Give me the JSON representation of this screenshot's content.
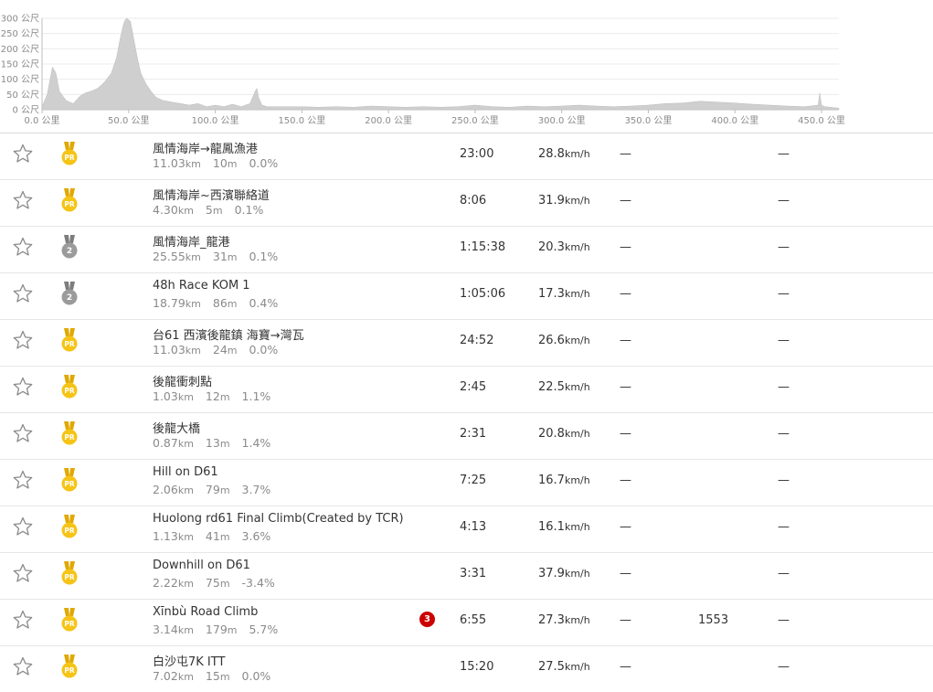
{
  "chart_data": {
    "type": "area",
    "ylim": [
      0,
      300
    ],
    "xlim": [
      0,
      460
    ],
    "y_ticks": [
      "0 公尺",
      "50 公尺",
      "100 公尺",
      "150 公尺",
      "200 公尺",
      "250 公尺",
      "300 公尺"
    ],
    "y_tick_values": [
      0,
      50,
      100,
      150,
      200,
      250,
      300
    ],
    "x_ticks": [
      "0.0 公里",
      "50.0 公里",
      "100.0 公里",
      "150.0 公里",
      "200.0 公里",
      "250.0 公里",
      "300.0 公里",
      "350.0 公里",
      "400.0 公里",
      "450.0 公里"
    ],
    "x_tick_values": [
      0,
      50,
      100,
      150,
      200,
      250,
      300,
      350,
      400,
      450
    ],
    "grid": true,
    "fill_color": "#cfcfcf",
    "x": [
      0,
      3,
      6,
      8,
      10,
      14,
      18,
      22,
      25,
      28,
      32,
      36,
      40,
      43,
      45,
      47,
      48,
      49,
      51,
      53,
      55,
      57,
      60,
      63,
      66,
      70,
      75,
      80,
      85,
      90,
      95,
      100,
      105,
      110,
      115,
      120,
      123,
      124,
      125,
      127,
      130,
      140,
      150,
      160,
      170,
      180,
      190,
      200,
      210,
      220,
      230,
      240,
      250,
      260,
      270,
      280,
      290,
      300,
      310,
      320,
      330,
      340,
      350,
      360,
      370,
      380,
      390,
      400,
      410,
      420,
      430,
      440,
      448,
      449,
      450,
      452,
      455,
      460
    ],
    "y": [
      10,
      50,
      140,
      120,
      60,
      30,
      20,
      45,
      55,
      60,
      70,
      90,
      120,
      170,
      230,
      280,
      295,
      300,
      290,
      230,
      170,
      120,
      85,
      60,
      40,
      30,
      25,
      20,
      15,
      20,
      10,
      15,
      10,
      18,
      10,
      20,
      60,
      70,
      40,
      15,
      10,
      10,
      10,
      8,
      10,
      8,
      12,
      10,
      8,
      10,
      8,
      10,
      15,
      10,
      8,
      12,
      10,
      12,
      15,
      12,
      10,
      12,
      15,
      20,
      22,
      28,
      25,
      22,
      18,
      15,
      12,
      10,
      15,
      55,
      15,
      10,
      8,
      5
    ]
  },
  "segments": [
    {
      "name": "風情海岸→龍鳳漁港",
      "distance": "11.03",
      "distance_unit": "km",
      "elev": "10",
      "elev_unit": "m",
      "grade": "0.0%",
      "medal": "pr",
      "medal_label": "PR",
      "time": "23:00",
      "speed": "28.8",
      "speed_unit": "km/h",
      "dash1": "—",
      "extra": "",
      "dash2": "—",
      "kom_rank": ""
    },
    {
      "name": "風情海岸~西濱聯絡道",
      "distance": "4.30",
      "distance_unit": "km",
      "elev": "5",
      "elev_unit": "m",
      "grade": "0.1%",
      "medal": "pr",
      "medal_label": "PR",
      "time": "8:06",
      "speed": "31.9",
      "speed_unit": "km/h",
      "dash1": "—",
      "extra": "",
      "dash2": "—",
      "kom_rank": ""
    },
    {
      "name": "風情海岸_龍港",
      "distance": "25.55",
      "distance_unit": "km",
      "elev": "31",
      "elev_unit": "m",
      "grade": "0.1%",
      "medal": "silver",
      "medal_label": "2",
      "time": "1:15:38",
      "speed": "20.3",
      "speed_unit": "km/h",
      "dash1": "—",
      "extra": "",
      "dash2": "—",
      "kom_rank": ""
    },
    {
      "name": "48h Race KOM 1",
      "distance": "18.79",
      "distance_unit": "km",
      "elev": "86",
      "elev_unit": "m",
      "grade": "0.4%",
      "medal": "silver",
      "medal_label": "2",
      "time": "1:05:06",
      "speed": "17.3",
      "speed_unit": "km/h",
      "dash1": "—",
      "extra": "",
      "dash2": "—",
      "kom_rank": ""
    },
    {
      "name": "台61 西濱後龍鎮 海寶→灣瓦",
      "distance": "11.03",
      "distance_unit": "km",
      "elev": "24",
      "elev_unit": "m",
      "grade": "0.0%",
      "medal": "pr",
      "medal_label": "PR",
      "time": "24:52",
      "speed": "26.6",
      "speed_unit": "km/h",
      "dash1": "—",
      "extra": "",
      "dash2": "—",
      "kom_rank": ""
    },
    {
      "name": "後龍衝刺點",
      "distance": "1.03",
      "distance_unit": "km",
      "elev": "12",
      "elev_unit": "m",
      "grade": "1.1%",
      "medal": "pr",
      "medal_label": "PR",
      "time": "2:45",
      "speed": "22.5",
      "speed_unit": "km/h",
      "dash1": "—",
      "extra": "",
      "dash2": "—",
      "kom_rank": ""
    },
    {
      "name": "後龍大橋",
      "distance": "0.87",
      "distance_unit": "km",
      "elev": "13",
      "elev_unit": "m",
      "grade": "1.4%",
      "medal": "pr",
      "medal_label": "PR",
      "time": "2:31",
      "speed": "20.8",
      "speed_unit": "km/h",
      "dash1": "—",
      "extra": "",
      "dash2": "—",
      "kom_rank": ""
    },
    {
      "name": "Hill on D61",
      "distance": "2.06",
      "distance_unit": "km",
      "elev": "79",
      "elev_unit": "m",
      "grade": "3.7%",
      "medal": "pr",
      "medal_label": "PR",
      "time": "7:25",
      "speed": "16.7",
      "speed_unit": "km/h",
      "dash1": "—",
      "extra": "",
      "dash2": "—",
      "kom_rank": ""
    },
    {
      "name": "Huolong rd61 Final Climb(Created by TCR)",
      "distance": "1.13",
      "distance_unit": "km",
      "elev": "41",
      "elev_unit": "m",
      "grade": "3.6%",
      "medal": "pr",
      "medal_label": "PR",
      "time": "4:13",
      "speed": "16.1",
      "speed_unit": "km/h",
      "dash1": "—",
      "extra": "",
      "dash2": "—",
      "kom_rank": ""
    },
    {
      "name": "Downhill on D61",
      "distance": "2.22",
      "distance_unit": "km",
      "elev": "75",
      "elev_unit": "m",
      "grade": "-3.4%",
      "medal": "pr",
      "medal_label": "PR",
      "time": "3:31",
      "speed": "37.9",
      "speed_unit": "km/h",
      "dash1": "—",
      "extra": "",
      "dash2": "—",
      "kom_rank": ""
    },
    {
      "name": "Xīnbù Road Climb",
      "distance": "3.14",
      "distance_unit": "km",
      "elev": "179",
      "elev_unit": "m",
      "grade": "5.7%",
      "medal": "pr",
      "medal_label": "PR",
      "time": "6:55",
      "speed": "27.3",
      "speed_unit": "km/h",
      "dash1": "—",
      "extra": "1553",
      "dash2": "—",
      "kom_rank": "3"
    },
    {
      "name": "白沙屯7K ITT",
      "distance": "7.02",
      "distance_unit": "km",
      "elev": "15",
      "elev_unit": "m",
      "grade": "0.0%",
      "medal": "pr",
      "medal_label": "PR",
      "time": "15:20",
      "speed": "27.5",
      "speed_unit": "km/h",
      "dash1": "—",
      "extra": "",
      "dash2": "—",
      "kom_rank": ""
    }
  ],
  "colors": {
    "pr_gold": "#f5c417",
    "pr_gold_dark": "#e0a800",
    "silver": "#9b9b9b",
    "silver_dark": "#7d7d7d",
    "kom_red": "#cc0000",
    "star_outline": "#8a8a8a"
  },
  "icons": {
    "favorite": "star-outline-icon",
    "pr": "pr-medal-icon",
    "rank": "rank-medal-icon"
  }
}
